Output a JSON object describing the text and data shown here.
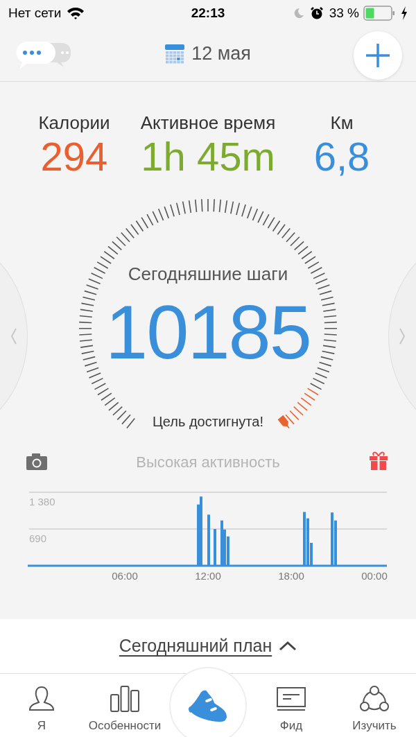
{
  "status_bar": {
    "carrier": "Нет сети",
    "time": "22:13",
    "battery_text": "33 %"
  },
  "header": {
    "date": "12 мая"
  },
  "stats": [
    {
      "label": "Калории",
      "value": "294",
      "color": "#ea5f2f"
    },
    {
      "label": "Активное время",
      "value": "1h 45m",
      "color": "#7cab2f"
    },
    {
      "label": "Км",
      "value": "6,8",
      "color": "#3a8fdb"
    }
  ],
  "gauge": {
    "title": "Сегодняшние шаги",
    "steps": "10185",
    "caption": "Цель достигнута!"
  },
  "activity": {
    "title": "Высокая активность",
    "chart_data": {
      "type": "bar",
      "x": [
        11.3,
        11.5,
        12.05,
        12.5,
        13.0,
        13.2,
        13.45,
        18.95,
        19.2,
        19.45,
        20.95,
        21.2
      ],
      "values": [
        1150,
        1300,
        960,
        690,
        850,
        680,
        550,
        1010,
        890,
        430,
        1000,
        850
      ],
      "xlim": [
        -1,
        24.9
      ],
      "ylim": [
        0,
        1380
      ],
      "xticks": [
        {
          "value": 6,
          "label": "06:00"
        },
        {
          "value": 12,
          "label": "12:00"
        },
        {
          "value": 18,
          "label": "18:00"
        },
        {
          "value": 24,
          "label": "00:00"
        }
      ],
      "yticks": [
        {
          "value": 690,
          "label": "690"
        },
        {
          "value": 1380,
          "label": "1 380"
        }
      ]
    }
  },
  "plan": {
    "label": "Сегодняшний план",
    "expanded": false
  },
  "nav": [
    {
      "kind": "tab",
      "label": "Я",
      "selected": false
    },
    {
      "kind": "tab",
      "label": "Особенности",
      "selected": false
    },
    {
      "kind": "center",
      "selected": true
    },
    {
      "kind": "tab",
      "label": "Фид",
      "selected": false
    },
    {
      "kind": "tab",
      "label": "Изучить",
      "selected": false
    }
  ]
}
